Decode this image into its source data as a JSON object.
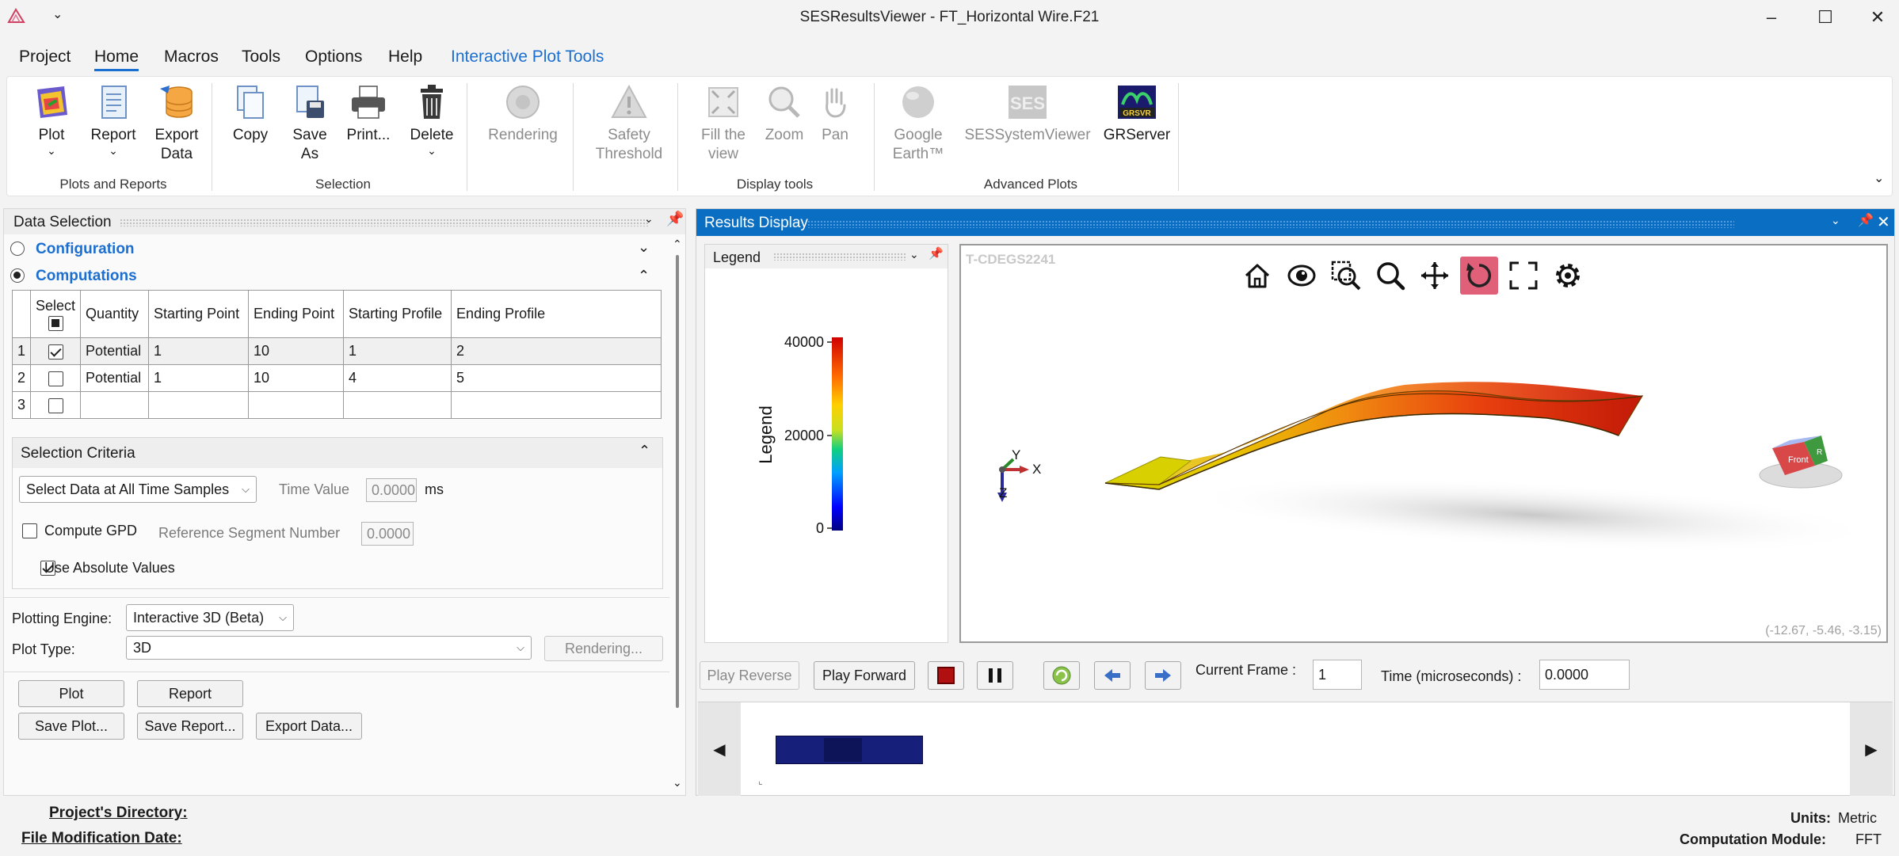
{
  "window": {
    "title": "SESResultsViewer - FT_Horizontal Wire.F21"
  },
  "menu": {
    "items": [
      "Project",
      "Home",
      "Macros",
      "Tools",
      "Options",
      "Help",
      "Interactive Plot Tools"
    ]
  },
  "ribbon": {
    "plot": "Plot",
    "report": "Report",
    "export_data": [
      "Export",
      "Data"
    ],
    "copy": "Copy",
    "save_as": [
      "Save",
      "As"
    ],
    "print": "Print...",
    "delete": "Delete",
    "rendering": "Rendering",
    "safety_threshold": [
      "Safety",
      "Threshold"
    ],
    "fill_view": [
      "Fill the",
      "view"
    ],
    "zoom": "Zoom",
    "pan": "Pan",
    "google_earth": [
      "Google",
      "Earth™"
    ],
    "ses_system_viewer": "SESSystemViewer",
    "grserver": "GRServer",
    "groups": {
      "plots_reports": "Plots and Reports",
      "selection": "Selection",
      "display_tools": "Display tools",
      "advanced_plots": "Advanced Plots"
    },
    "logo_ses": "SES",
    "logo_grsvr": "GRSVR"
  },
  "data_selection": {
    "title": "Data Selection",
    "configuration": "Configuration",
    "computations": "Computations",
    "table": {
      "headers": [
        "Select",
        "Quantity",
        "Starting Point",
        "Ending Point",
        "Starting Profile",
        "Ending Profile"
      ],
      "rows": [
        {
          "num": "1",
          "checked": true,
          "quantity": "Potential",
          "start_point": "1",
          "end_point": "10",
          "start_profile": "1",
          "end_profile": "2"
        },
        {
          "num": "2",
          "checked": false,
          "quantity": "Potential",
          "start_point": "1",
          "end_point": "10",
          "start_profile": "4",
          "end_profile": "5"
        },
        {
          "num": "3",
          "checked": false,
          "quantity": "",
          "start_point": "",
          "end_point": "",
          "start_profile": "",
          "end_profile": ""
        }
      ]
    },
    "criteria": {
      "title": "Selection Criteria",
      "time_select": "Select Data at All Time Samples",
      "time_value_label": "Time Value",
      "time_value": "0.0000",
      "time_unit": "ms",
      "compute_gpd": "Compute GPD",
      "ref_segment_label": "Reference Segment Number",
      "ref_segment": "0.0000",
      "use_absolute": "Use Absolute Values"
    },
    "plotting_engine_label": "Plotting Engine:",
    "plotting_engine": "Interactive 3D (Beta)",
    "plot_type_label": "Plot Type:",
    "plot_type": "3D",
    "rendering_btn": "Rendering...",
    "buttons": {
      "plot": "Plot",
      "report": "Report",
      "save_plot": "Save Plot...",
      "save_report": "Save Report...",
      "export_data": "Export Data..."
    }
  },
  "results": {
    "title": "Results Display",
    "legend_title": "Legend",
    "legend_axis_label": "Legend",
    "legend_ticks": [
      "40000",
      "20000",
      "0"
    ],
    "watermark": "T-CDEGS2241",
    "axis_labels": {
      "x": "X",
      "y": "Y",
      "z": "Z"
    },
    "cube_front": "Front",
    "cube_right": "R",
    "coords": "(-12.67, -5.46, -3.15)",
    "play_reverse": "Play Reverse",
    "play_forward": "Play Forward",
    "current_frame_label": "Current Frame :",
    "current_frame": "1",
    "time_label": "Time (microseconds) :",
    "time_value": "0.0000"
  },
  "status": {
    "project_dir_label": "Project's Directory:",
    "file_mod_label": "File Modification Date:",
    "units_label": "Units:",
    "units_value": "Metric",
    "module_label": "Computation Module:",
    "module_value": "FFT"
  },
  "colors": {
    "accent": "#1b6fd0",
    "results_header": "#0a6fc2",
    "active_tool": "#e0607a"
  }
}
